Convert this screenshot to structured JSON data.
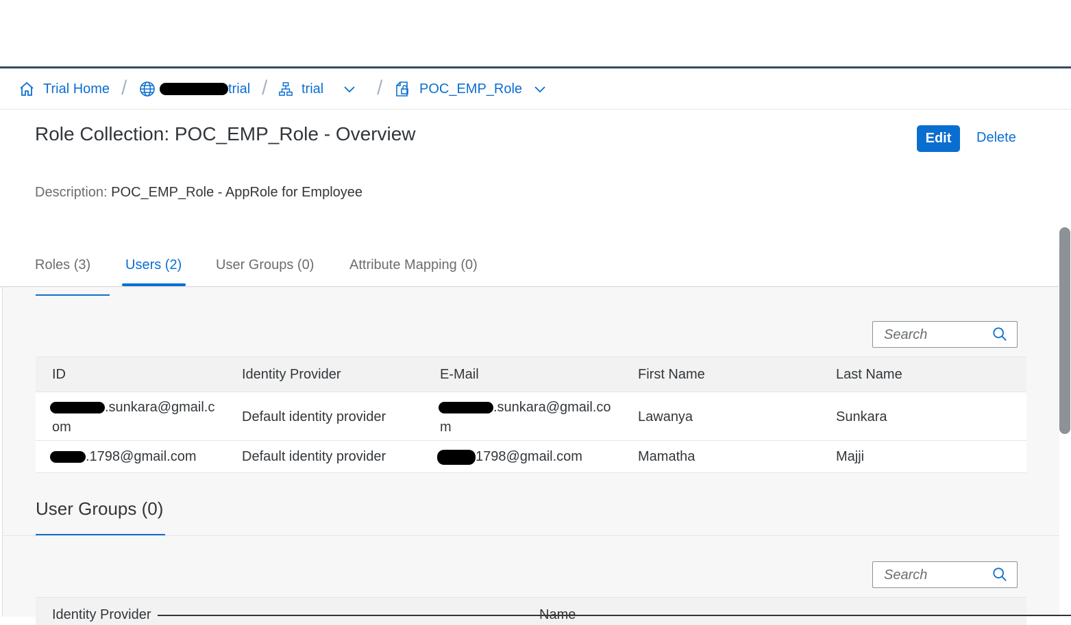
{
  "breadcrumb": {
    "home": "Trial Home",
    "subaccount": "trial",
    "space": "trial",
    "role_collection": "POC_EMP_Role"
  },
  "header": {
    "title": "Role Collection: POC_EMP_Role - Overview",
    "edit_label": "Edit",
    "delete_label": "Delete",
    "description_label": "Description:",
    "description_value": "POC_EMP_Role - AppRole for Employee"
  },
  "tabs": [
    {
      "label": "Roles (3)"
    },
    {
      "label": "Users (2)"
    },
    {
      "label": "User Groups (0)"
    },
    {
      "label": "Attribute Mapping (0)"
    }
  ],
  "users": {
    "search_placeholder": "Search",
    "columns": [
      "ID",
      "Identity Provider",
      "E-Mail",
      "First Name",
      "Last Name"
    ],
    "rows": [
      {
        "id_l1": ".sunkara@gmail.c",
        "id_l2": "om",
        "idp": "Default identity provider",
        "email_l1": ".sunkara@gmail.co",
        "email_l2": "m",
        "first": "Lawanya",
        "last": "Sunkara"
      },
      {
        "id": ".1798@gmail.com",
        "idp": "Default identity provider",
        "email": "1798@gmail.com",
        "first": "Mamatha",
        "last": "Majji"
      }
    ]
  },
  "user_groups": {
    "title": "User Groups (0)",
    "search_placeholder": "Search",
    "columns": [
      "Identity Provider",
      "Name"
    ]
  },
  "colors": {
    "accent": "#0a6ed1",
    "shell": "#354a5f"
  }
}
